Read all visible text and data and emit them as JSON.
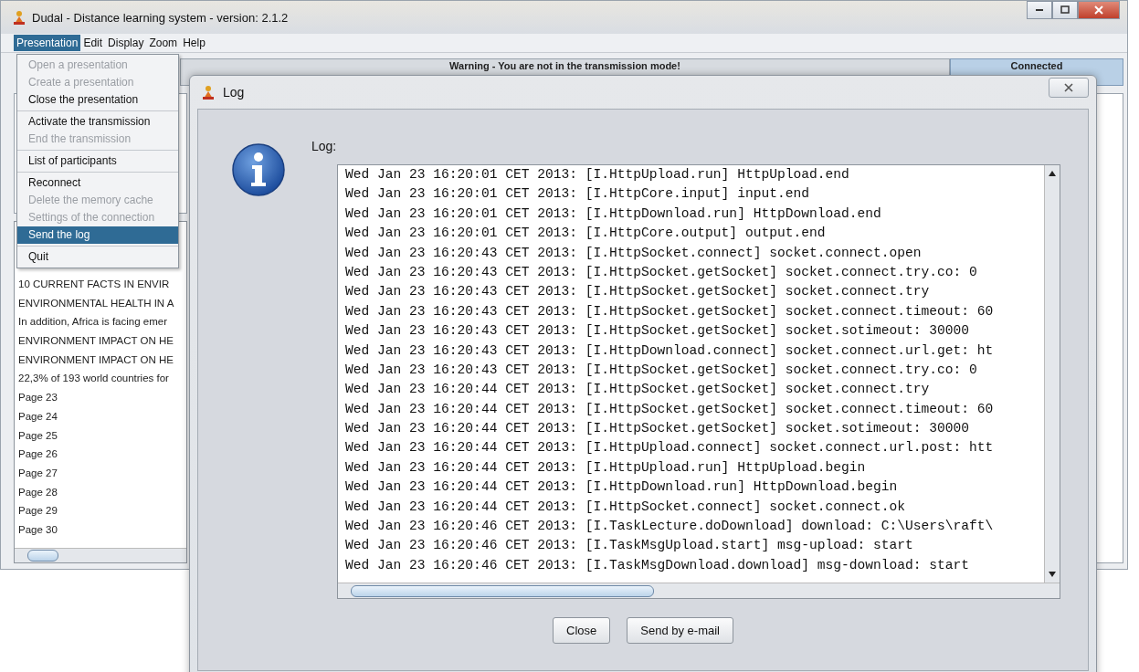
{
  "window": {
    "title": "Dudal - Distance learning system - version: 2.1.2"
  },
  "menubar": [
    {
      "label": "Presentation",
      "selected": true
    },
    {
      "label": "Edit",
      "selected": false
    },
    {
      "label": "Display",
      "selected": false
    },
    {
      "label": "Zoom",
      "selected": false
    },
    {
      "label": "Help",
      "selected": false
    }
  ],
  "menu": {
    "groups": [
      [
        {
          "label": "Open a presentation",
          "disabled": true,
          "selected": false
        },
        {
          "label": "Create a presentation",
          "disabled": true,
          "selected": false
        },
        {
          "label": "Close the presentation",
          "disabled": false,
          "selected": false
        }
      ],
      [
        {
          "label": "Activate the transmission",
          "disabled": false,
          "selected": false
        },
        {
          "label": "End the transmission",
          "disabled": true,
          "selected": false
        }
      ],
      [
        {
          "label": "List of participants",
          "disabled": false,
          "selected": false
        }
      ],
      [
        {
          "label": "Reconnect",
          "disabled": false,
          "selected": false
        },
        {
          "label": "Delete the memory cache",
          "disabled": true,
          "selected": false
        },
        {
          "label": "Settings of the connection",
          "disabled": true,
          "selected": false
        },
        {
          "label": "Send the log",
          "disabled": false,
          "selected": true
        }
      ],
      [
        {
          "label": "Quit",
          "disabled": false,
          "selected": false
        }
      ]
    ]
  },
  "status": {
    "warning": "Warning - You are not in the transmission mode!",
    "connection": "Connected"
  },
  "pages": [
    "10 CURRENT FACTS IN ENVIR",
    "ENVIRONMENTAL HEALTH IN A",
    "In addition, Africa is facing emer",
    "ENVIRONMENT IMPACT ON HE",
    "ENVIRONMENT IMPACT ON HE",
    "22,3% of 193 world countries for",
    "Page 23",
    "Page 24",
    "Page 25",
    "Page 26",
    "Page 27",
    "Page 28",
    "Page 29",
    "Page 30"
  ],
  "dialog": {
    "title": "Log",
    "label": "Log:",
    "lines": [
      "Wed Jan 23 16:20:01 CET 2013: [I.HttpUpload.run] HttpUpload.end",
      "Wed Jan 23 16:20:01 CET 2013: [I.HttpCore.input] input.end",
      "Wed Jan 23 16:20:01 CET 2013: [I.HttpDownload.run] HttpDownload.end",
      "Wed Jan 23 16:20:01 CET 2013: [I.HttpCore.output] output.end",
      "Wed Jan 23 16:20:43 CET 2013: [I.HttpSocket.connect] socket.connect.open",
      "Wed Jan 23 16:20:43 CET 2013: [I.HttpSocket.getSocket] socket.connect.try.co: 0",
      "Wed Jan 23 16:20:43 CET 2013: [I.HttpSocket.getSocket] socket.connect.try",
      "Wed Jan 23 16:20:43 CET 2013: [I.HttpSocket.getSocket] socket.connect.timeout: 60",
      "Wed Jan 23 16:20:43 CET 2013: [I.HttpSocket.getSocket] socket.sotimeout: 30000",
      "Wed Jan 23 16:20:43 CET 2013: [I.HttpDownload.connect] socket.connect.url.get: ht",
      "Wed Jan 23 16:20:43 CET 2013: [I.HttpSocket.getSocket] socket.connect.try.co: 0",
      "Wed Jan 23 16:20:44 CET 2013: [I.HttpSocket.getSocket] socket.connect.try",
      "Wed Jan 23 16:20:44 CET 2013: [I.HttpSocket.getSocket] socket.connect.timeout: 60",
      "Wed Jan 23 16:20:44 CET 2013: [I.HttpSocket.getSocket] socket.sotimeout: 30000",
      "Wed Jan 23 16:20:44 CET 2013: [I.HttpUpload.connect] socket.connect.url.post: htt",
      "Wed Jan 23 16:20:44 CET 2013: [I.HttpUpload.run] HttpUpload.begin",
      "Wed Jan 23 16:20:44 CET 2013: [I.HttpDownload.run] HttpDownload.begin",
      "Wed Jan 23 16:20:44 CET 2013: [I.HttpSocket.connect] socket.connect.ok",
      "Wed Jan 23 16:20:46 CET 2013: [I.TaskLecture.doDownload] download: C:\\Users\\raft\\",
      "Wed Jan 23 16:20:46 CET 2013: [I.TaskMsgUpload.start] msg-upload: start",
      "Wed Jan 23 16:20:46 CET 2013: [I.TaskMsgDownload.download] msg-download: start"
    ],
    "buttons": [
      "Close",
      "Send by e-mail"
    ]
  }
}
